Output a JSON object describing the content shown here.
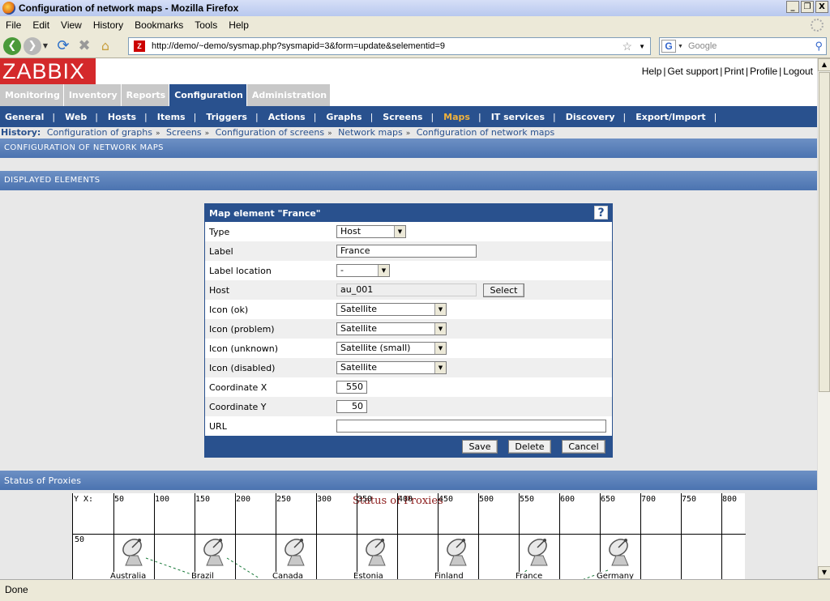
{
  "window": {
    "title": "Configuration of network maps - Mozilla Firefox",
    "buttons": [
      "_",
      "❐",
      "X"
    ]
  },
  "menu": [
    "File",
    "Edit",
    "View",
    "History",
    "Bookmarks",
    "Tools",
    "Help"
  ],
  "toolbar": {
    "url": "http://demo/~demo/sysmap.php?sysmapid=3&form=update&selementid=9",
    "search_placeholder": "Google",
    "favicon": "Z"
  },
  "zabbix": {
    "logo": "ZABBIX",
    "top_links": [
      "Help",
      "Get support",
      "Print",
      "Profile",
      "Logout"
    ],
    "main_tabs": [
      "Monitoring",
      "Inventory",
      "Reports",
      "Configuration",
      "Administration"
    ],
    "active_main_tab": "Configuration",
    "sub_nav": [
      "General",
      "Web",
      "Hosts",
      "Items",
      "Triggers",
      "Actions",
      "Graphs",
      "Screens",
      "Maps",
      "IT services",
      "Discovery",
      "Export/Import"
    ],
    "active_sub": "Maps",
    "history_label": "History:",
    "history": [
      "Configuration of graphs",
      "Screens",
      "Configuration of screens",
      "Network maps",
      "Configuration of network maps"
    ],
    "section_title": "CONFIGURATION OF NETWORK MAPS",
    "displayed_title": "DISPLAYED ELEMENTS",
    "proxies_title": "Status of Proxies"
  },
  "form": {
    "title": "Map element \"France\"",
    "help": "?",
    "rows": {
      "type": {
        "label": "Type",
        "value": "Host"
      },
      "label": {
        "label": "Label",
        "value": "France"
      },
      "label_location": {
        "label": "Label location",
        "value": "-"
      },
      "host": {
        "label": "Host",
        "value": "au_001",
        "button": "Select"
      },
      "icon_ok": {
        "label": "Icon (ok)",
        "value": "Satellite"
      },
      "icon_problem": {
        "label": "Icon (problem)",
        "value": "Satellite"
      },
      "icon_unknown": {
        "label": "Icon (unknown)",
        "value": "Satellite (small)"
      },
      "icon_disabled": {
        "label": "Icon (disabled)",
        "value": "Satellite"
      },
      "coord_x": {
        "label": "Coordinate X",
        "value": "550"
      },
      "coord_y": {
        "label": "Coordinate Y",
        "value": "50"
      },
      "url": {
        "label": "URL",
        "value": ""
      }
    },
    "buttons": {
      "save": "Save",
      "delete": "Delete",
      "cancel": "Cancel"
    }
  },
  "map": {
    "title": "Status of Proxies",
    "axis_label": "Y X:",
    "x_ticks": [
      "50",
      "100",
      "150",
      "200",
      "250",
      "300",
      "350",
      "400",
      "450",
      "500",
      "550",
      "600",
      "650",
      "700",
      "750",
      "800"
    ],
    "y_ticks": [
      "50"
    ],
    "elements": [
      "Australia",
      "Brazil",
      "Canada",
      "Estonia",
      "Finland",
      "France",
      "Germany"
    ]
  },
  "status": "Done"
}
